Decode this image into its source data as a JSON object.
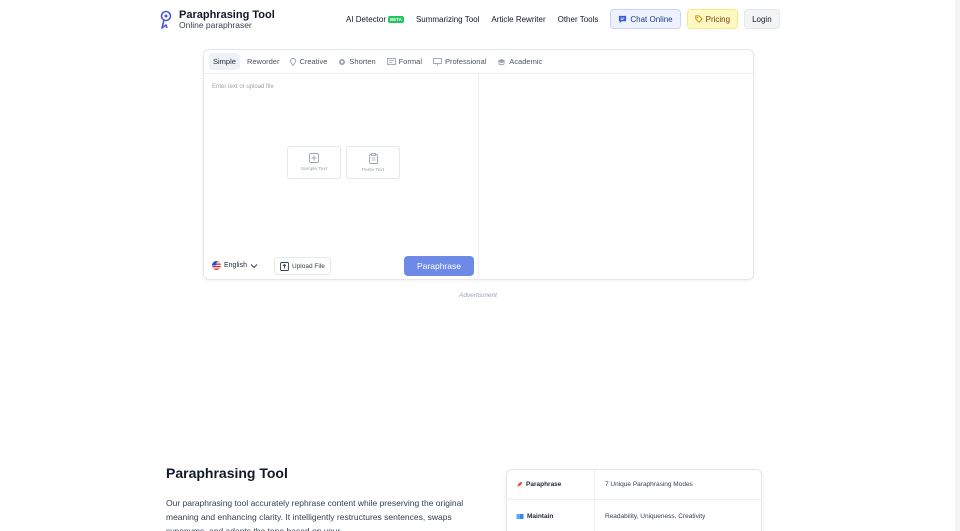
{
  "header": {
    "logo_title": "Paraphrasing Tool",
    "logo_subtitle": "Online paraphraser",
    "nav": {
      "ai_detector": "AI Detector",
      "beta_badge": "BETA",
      "summarizing": "Summarizing Tool",
      "rewriter": "Article Rewriter",
      "other": "Other Tools",
      "chat": "Chat Online",
      "pricing": "Pricing",
      "login": "Login"
    }
  },
  "editor": {
    "modes": [
      "Simple",
      "Reworder",
      "Creative",
      "Shorten",
      "Formal",
      "Professional",
      "Academic"
    ],
    "active_mode": "Simple",
    "input_placeholder": "Enter text or upload file",
    "sample_text": "Sample Text",
    "paste_text": "Paste Text",
    "language": "English",
    "upload_label": "Upload File",
    "paraphrase_label": "Paraphrase"
  },
  "ad_label": "Advertisment",
  "section": {
    "title": "Paraphrasing Tool",
    "paragraph": "Our paraphrasing tool accurately rephrase content while preserving the original meaning and enhancing clarity. It intelligently restructures sentences, swaps synonyms, and adapts the tone based on your",
    "features": [
      {
        "key": "Paraphrase",
        "value": "7 Unique Paraphrasing Modes"
      },
      {
        "key": "Maintain",
        "value": "Readability, Uniqueness, Creativity"
      }
    ]
  },
  "colors": {
    "accent": "#6d8ae6",
    "beta": "#22c55e",
    "chat_bg": "#eef2ff",
    "pricing_bg": "#fef9c3"
  }
}
